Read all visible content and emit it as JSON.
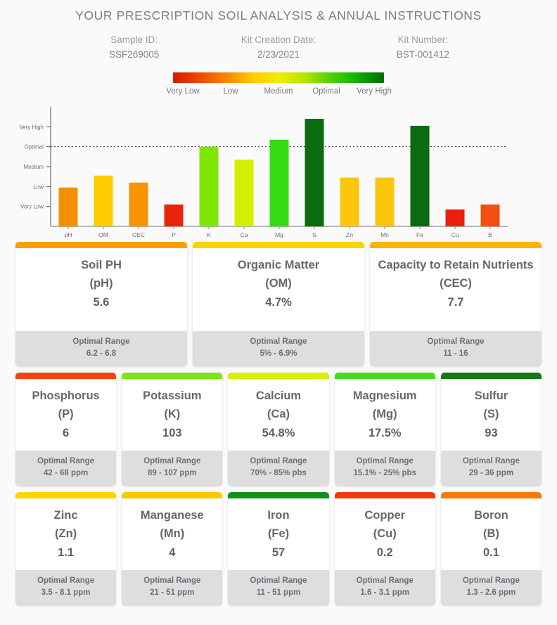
{
  "header": {
    "title": "YOUR PRESCRIPTION SOIL ANALYSIS & ANNUAL INSTRUCTIONS",
    "sample_id_label": "Sample ID:",
    "sample_id_value": "SSF269005",
    "kit_date_label": "Kit Creation Date:",
    "kit_date_value": "2/23/2021",
    "kit_number_label": "Kit Number:",
    "kit_number_value": "BST-001412"
  },
  "legend": {
    "labels": [
      "Very Low",
      "Low",
      "Medium",
      "Optimal",
      "Very High"
    ],
    "gradient_stops": [
      "#d41a00",
      "#f77f00",
      "#f2ec00",
      "#55d400",
      "#036b00"
    ]
  },
  "chart_data": {
    "type": "bar",
    "title": "",
    "xlabel": "",
    "ylabel": "",
    "grid": false,
    "legend_position": "top",
    "y_tick_labels": [
      "Very High",
      "Optimal",
      "Medium",
      "Low",
      "Very Low"
    ],
    "y_tick_values": [
      5,
      4,
      3,
      2,
      1
    ],
    "ylim": [
      0,
      6
    ],
    "optimal_reference_line": 4,
    "categories": [
      "pH",
      "OM",
      "CEC",
      "P",
      "K",
      "Ca",
      "Mg",
      "S",
      "Zn",
      "Mn",
      "Fe",
      "Cu",
      "B"
    ],
    "values": [
      1.95,
      2.55,
      2.2,
      1.1,
      4.0,
      3.35,
      4.35,
      5.4,
      2.45,
      2.45,
      5.05,
      0.85,
      1.1
    ],
    "bar_colors": [
      "#f59100",
      "#ffcc00",
      "#f79400",
      "#e8250c",
      "#7ee600",
      "#d4f000",
      "#33dd11",
      "#0a6b10",
      "#fcc60c",
      "#fcc60c",
      "#0a6b10",
      "#e8200c",
      "#f34e0e"
    ],
    "ratings": [
      "Low",
      "Medium",
      "Low",
      "Very Low",
      "Optimal",
      "Medium",
      "Optimal",
      "Very High",
      "Low",
      "Low",
      "Very High",
      "Very Low",
      "Very Low"
    ]
  },
  "cards": {
    "optimal_range_label": "Optimal Range",
    "major": [
      {
        "name": "Soil PH",
        "symbol": "(pH)",
        "value": "5.6",
        "range": "6.2 - 6.8",
        "accent": "#f7a100"
      },
      {
        "name": "Organic Matter",
        "symbol": "(OM)",
        "value": "4.7%",
        "range": "5% - 6.9%",
        "accent": "#fdd400"
      },
      {
        "name": "Capacity to Retain Nutrients",
        "symbol": "(CEC)",
        "value": "7.7",
        "range": "11 - 16",
        "accent": "#fbb501"
      }
    ],
    "macro": [
      {
        "name": "Phosphorus",
        "symbol": "(P)",
        "value": "6",
        "range": "42 - 68 ppm",
        "accent": "#f2440c"
      },
      {
        "name": "Potassium",
        "symbol": "(K)",
        "value": "103",
        "range": "89 - 107 ppm",
        "accent": "#81e218"
      },
      {
        "name": "Calcium",
        "symbol": "(Ca)",
        "value": "54.8%",
        "range": "70% - 85% pbs",
        "accent": "#d7f000"
      },
      {
        "name": "Magnesium",
        "symbol": "(Mg)",
        "value": "17.5%",
        "range": "15.1% - 25% pbs",
        "accent": "#41dc1a"
      },
      {
        "name": "Sulfur",
        "symbol": "(S)",
        "value": "93",
        "range": "29 - 36 ppm",
        "accent": "#17761a"
      }
    ],
    "micro": [
      {
        "name": "Zinc",
        "symbol": "(Zn)",
        "value": "1.1",
        "range": "3.5 - 8.1 ppm",
        "accent": "#fdd400"
      },
      {
        "name": "Manganese",
        "symbol": "(Mn)",
        "value": "4",
        "range": "21 - 51 ppm",
        "accent": "#fbc800"
      },
      {
        "name": "Iron",
        "symbol": "(Fe)",
        "value": "57",
        "range": "11 - 51 ppm",
        "accent": "#10921a"
      },
      {
        "name": "Copper",
        "symbol": "(Cu)",
        "value": "0.2",
        "range": "1.6 - 3.1 ppm",
        "accent": "#ec3c0a"
      },
      {
        "name": "Boron",
        "symbol": "(B)",
        "value": "0.1",
        "range": "1.3 - 2.6 ppm",
        "accent": "#f77a09"
      }
    ]
  }
}
